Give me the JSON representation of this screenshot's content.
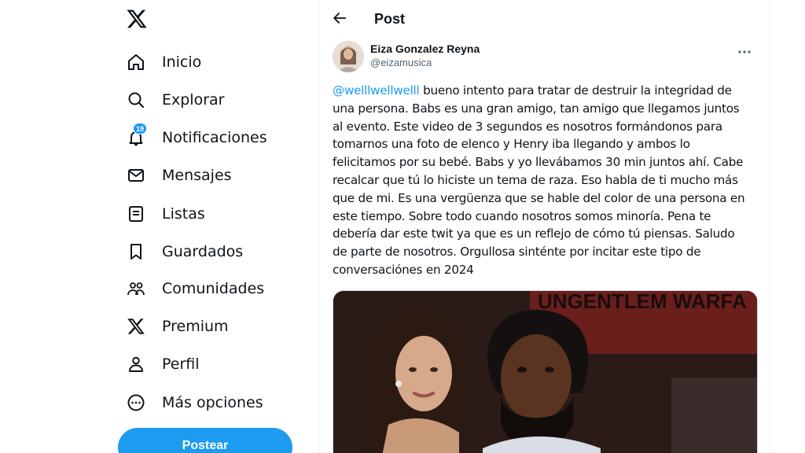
{
  "nav": {
    "items": [
      {
        "label": "Inicio",
        "icon": "home-icon"
      },
      {
        "label": "Explorar",
        "icon": "search-icon"
      },
      {
        "label": "Notificaciones",
        "icon": "bell-icon",
        "badge": "19"
      },
      {
        "label": "Mensajes",
        "icon": "envelope-icon"
      },
      {
        "label": "Listas",
        "icon": "list-icon"
      },
      {
        "label": "Guardados",
        "icon": "bookmark-icon"
      },
      {
        "label": "Comunidades",
        "icon": "people-icon"
      },
      {
        "label": "Premium",
        "icon": "x-logo-icon"
      },
      {
        "label": "Perfil",
        "icon": "person-icon"
      },
      {
        "label": "Más opciones",
        "icon": "more-circle-icon"
      }
    ],
    "post_button": "Postear"
  },
  "header": {
    "title": "Post"
  },
  "tweet": {
    "author_name": "Eiza Gonzalez Reyna",
    "author_handle": "@eizamusica",
    "mention": "@welllwellwelll",
    "body": " bueno intento para tratar de destruir la integridad de una persona. Babs es una gran amigo, tan amigo que llegamos juntos al evento. Este video de 3 segundos es nosotros formándonos para tomarnos una foto de elenco y Henry iba llegando y ambos lo felicitamos por su bebé. Babs y yo llevábamos 30 min juntos ahí. Cabe recalcar que tú lo hiciste un tema de raza. Eso habla de ti mucho más que de mi. Es una vergüenza que se hable del color de una persona en este tiempo. Sobre todo cuando nosotros somos minoría. Pena te debería dar este twit ya que es un reflejo de cómo tú piensas. Saludo de parte de nosotros. Orgullosa sinténte por incitar este tipo de conversaciónes en 2024",
    "media_backdrop_text": "UNGENTLEM WARFA"
  },
  "colors": {
    "accent": "#1d9bf0",
    "text": "#0f1419",
    "muted": "#536471"
  }
}
